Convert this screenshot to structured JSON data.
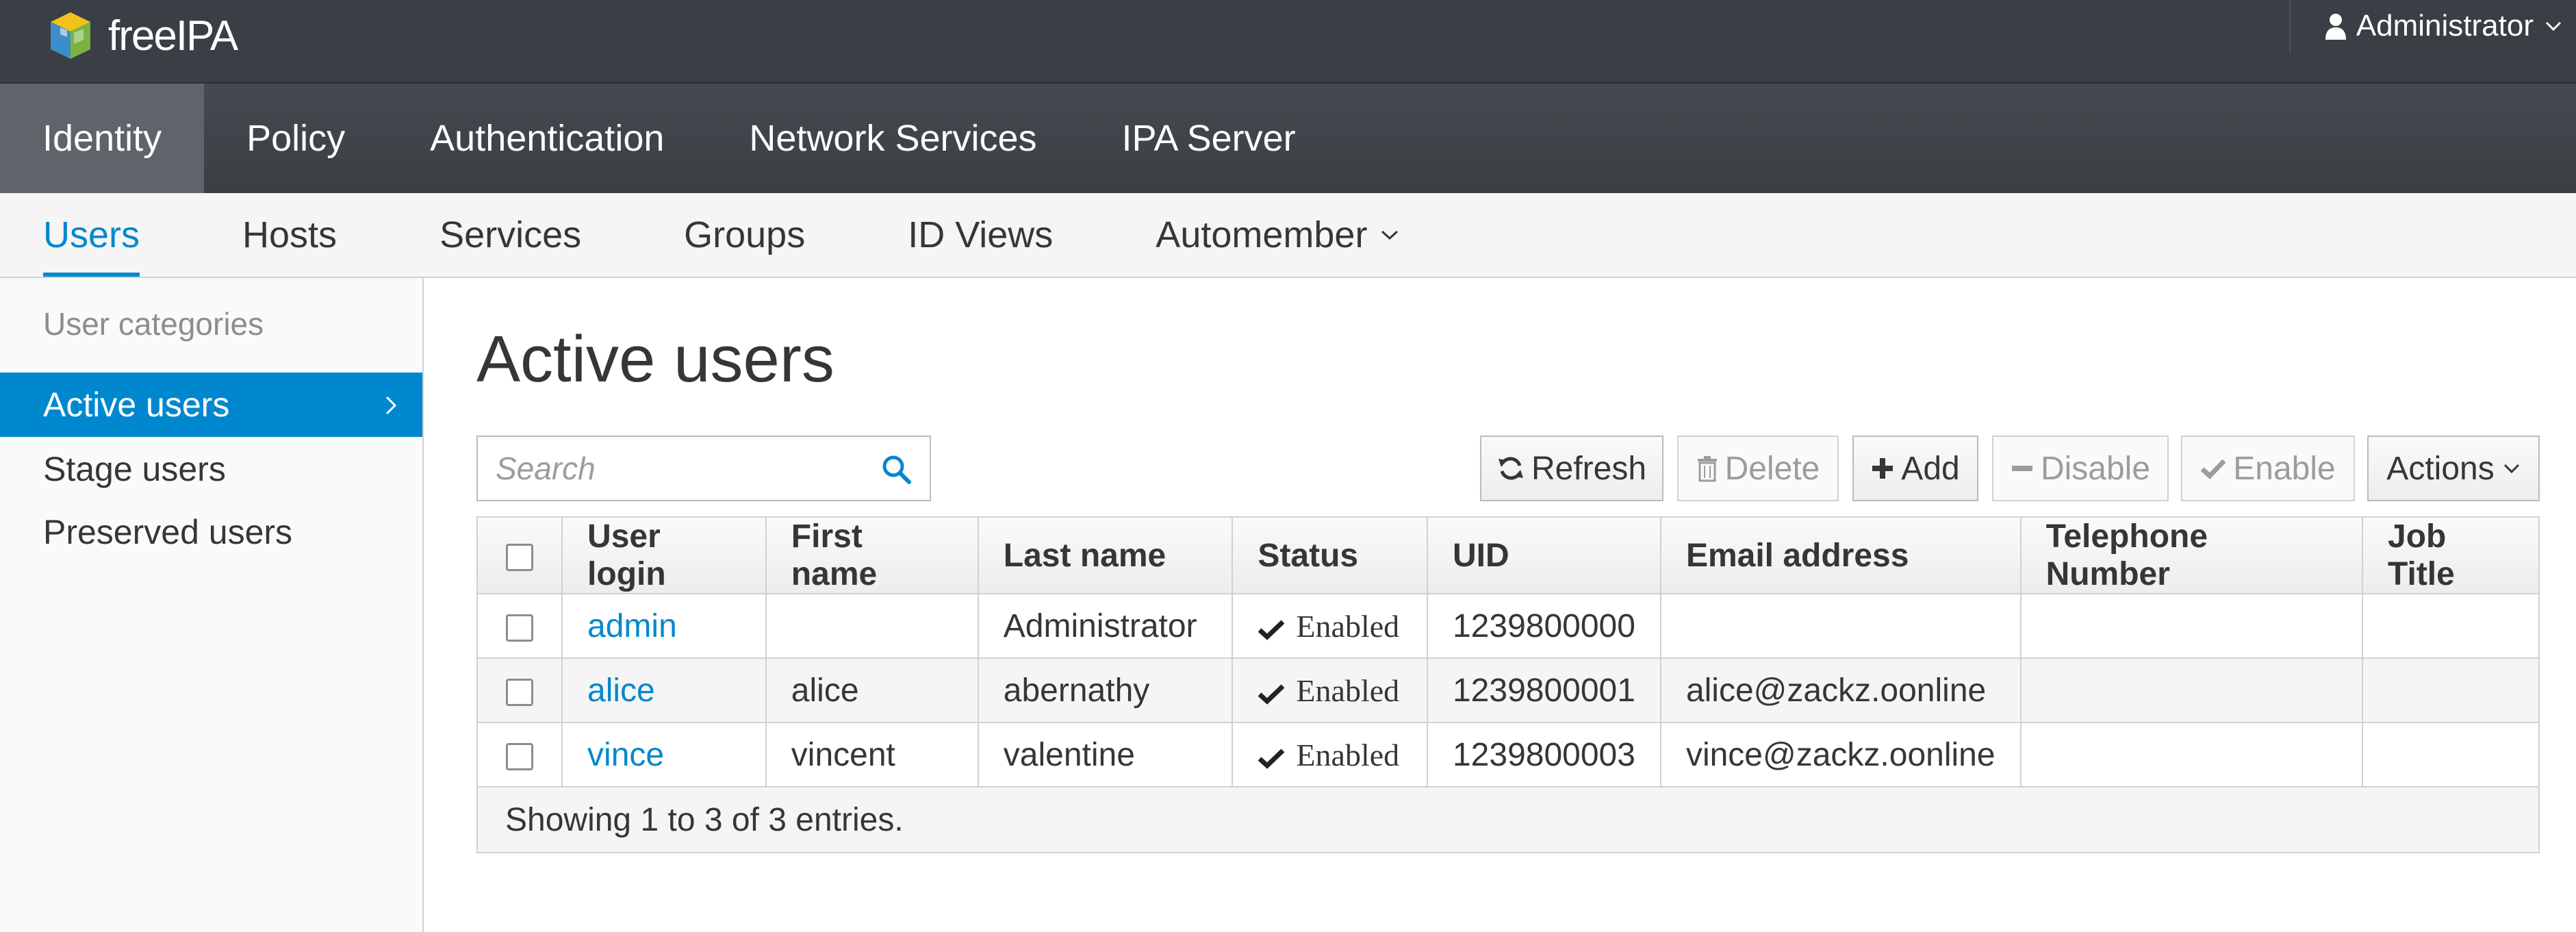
{
  "header": {
    "brand": "freeIPA",
    "user": "Administrator"
  },
  "main_nav": [
    "Identity",
    "Policy",
    "Authentication",
    "Network Services",
    "IPA Server"
  ],
  "sub_nav": [
    "Users",
    "Hosts",
    "Services",
    "Groups",
    "ID Views",
    "Automember"
  ],
  "sidebar": {
    "heading": "User categories",
    "items": [
      "Active users",
      "Stage users",
      "Preserved users"
    ]
  },
  "page": {
    "title": "Active users",
    "search_placeholder": "Search"
  },
  "toolbar": {
    "refresh": "Refresh",
    "delete": "Delete",
    "add": "Add",
    "disable": "Disable",
    "enable": "Enable",
    "actions": "Actions"
  },
  "table": {
    "columns": [
      "User login",
      "First name",
      "Last name",
      "Status",
      "UID",
      "Email address",
      "Telephone Number",
      "Job Title"
    ],
    "rows": [
      {
        "login": "admin",
        "first": "",
        "last": "Administrator",
        "status": "Enabled",
        "uid": "1239800000",
        "email": "",
        "phone": "",
        "job": ""
      },
      {
        "login": "alice",
        "first": "alice",
        "last": "abernathy",
        "status": "Enabled",
        "uid": "1239800001",
        "email": "alice@zackz.oonline",
        "phone": "",
        "job": ""
      },
      {
        "login": "vince",
        "first": "vincent",
        "last": "valentine",
        "status": "Enabled",
        "uid": "1239800003",
        "email": "vince@zackz.oonline",
        "phone": "",
        "job": ""
      }
    ],
    "footer": "Showing 1 to 3 of 3 entries."
  },
  "colors": {
    "header_bg": "#393f44",
    "accent": "#0088ce",
    "active_nav": "#5f646a"
  }
}
